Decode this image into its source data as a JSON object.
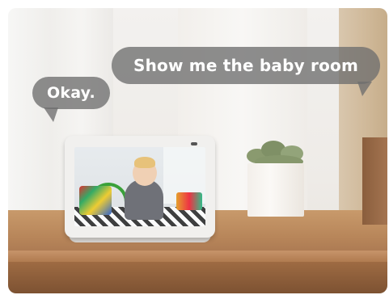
{
  "bubbles": {
    "reply": "Okay.",
    "command": "Show me the baby room"
  },
  "colors": {
    "bubble": "#6e6e6e",
    "bubble_text": "#ffffff",
    "table": "#b8865a",
    "device": "#f1f0ee"
  }
}
